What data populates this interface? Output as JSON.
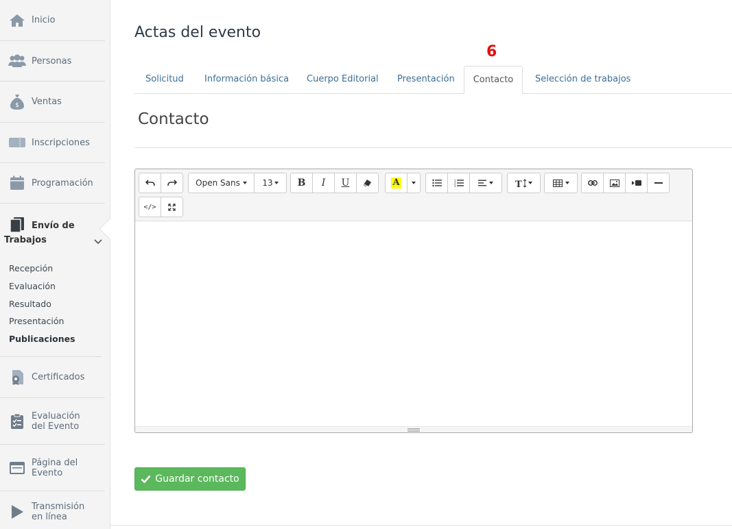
{
  "sidebar": {
    "items": [
      {
        "label": "Inicio",
        "icon": "home-icon"
      },
      {
        "label": "Personas",
        "icon": "users-icon"
      },
      {
        "label": "Ventas",
        "icon": "money-bag-icon"
      },
      {
        "label": "Inscripciones",
        "icon": "ticket-icon"
      },
      {
        "label": "Programación",
        "icon": "calendar-icon"
      }
    ],
    "active": {
      "label_line1": "Envío de",
      "label_line2": "Trabajos",
      "icon": "documents-icon",
      "subitems": [
        "Recepción",
        "Evaluación",
        "Resultado",
        "Presentación",
        "Publicaciones"
      ],
      "selected_subitem": "Publicaciones"
    },
    "items_after": [
      {
        "label": "Certificados",
        "icon": "certificate-icon"
      },
      {
        "label": "Evaluación del Evento",
        "icon": "clipboard-icon"
      },
      {
        "label": "Página del Evento",
        "icon": "browser-window-icon"
      },
      {
        "label": "Transmisión en línea",
        "icon": "play-icon"
      }
    ]
  },
  "page": {
    "title": "Actas del evento",
    "step_number": "6"
  },
  "tabs": [
    {
      "label": "Solicitud"
    },
    {
      "label": "Información básica"
    },
    {
      "label": "Cuerpo Editorial"
    },
    {
      "label": "Presentación"
    },
    {
      "label": "Contacto"
    },
    {
      "label": "Selección de trabajos"
    }
  ],
  "active_tab": "Contacto",
  "section": {
    "title": "Contacto"
  },
  "editor": {
    "font_family": "Open Sans",
    "font_size": "13",
    "content": ""
  },
  "actions": {
    "save_label": "Guardar contacto"
  },
  "colors": {
    "link_blue": "#3b6e96",
    "success_green": "#5cb85c",
    "step_red": "#e01010",
    "highlight_yellow": "#ffff00"
  }
}
